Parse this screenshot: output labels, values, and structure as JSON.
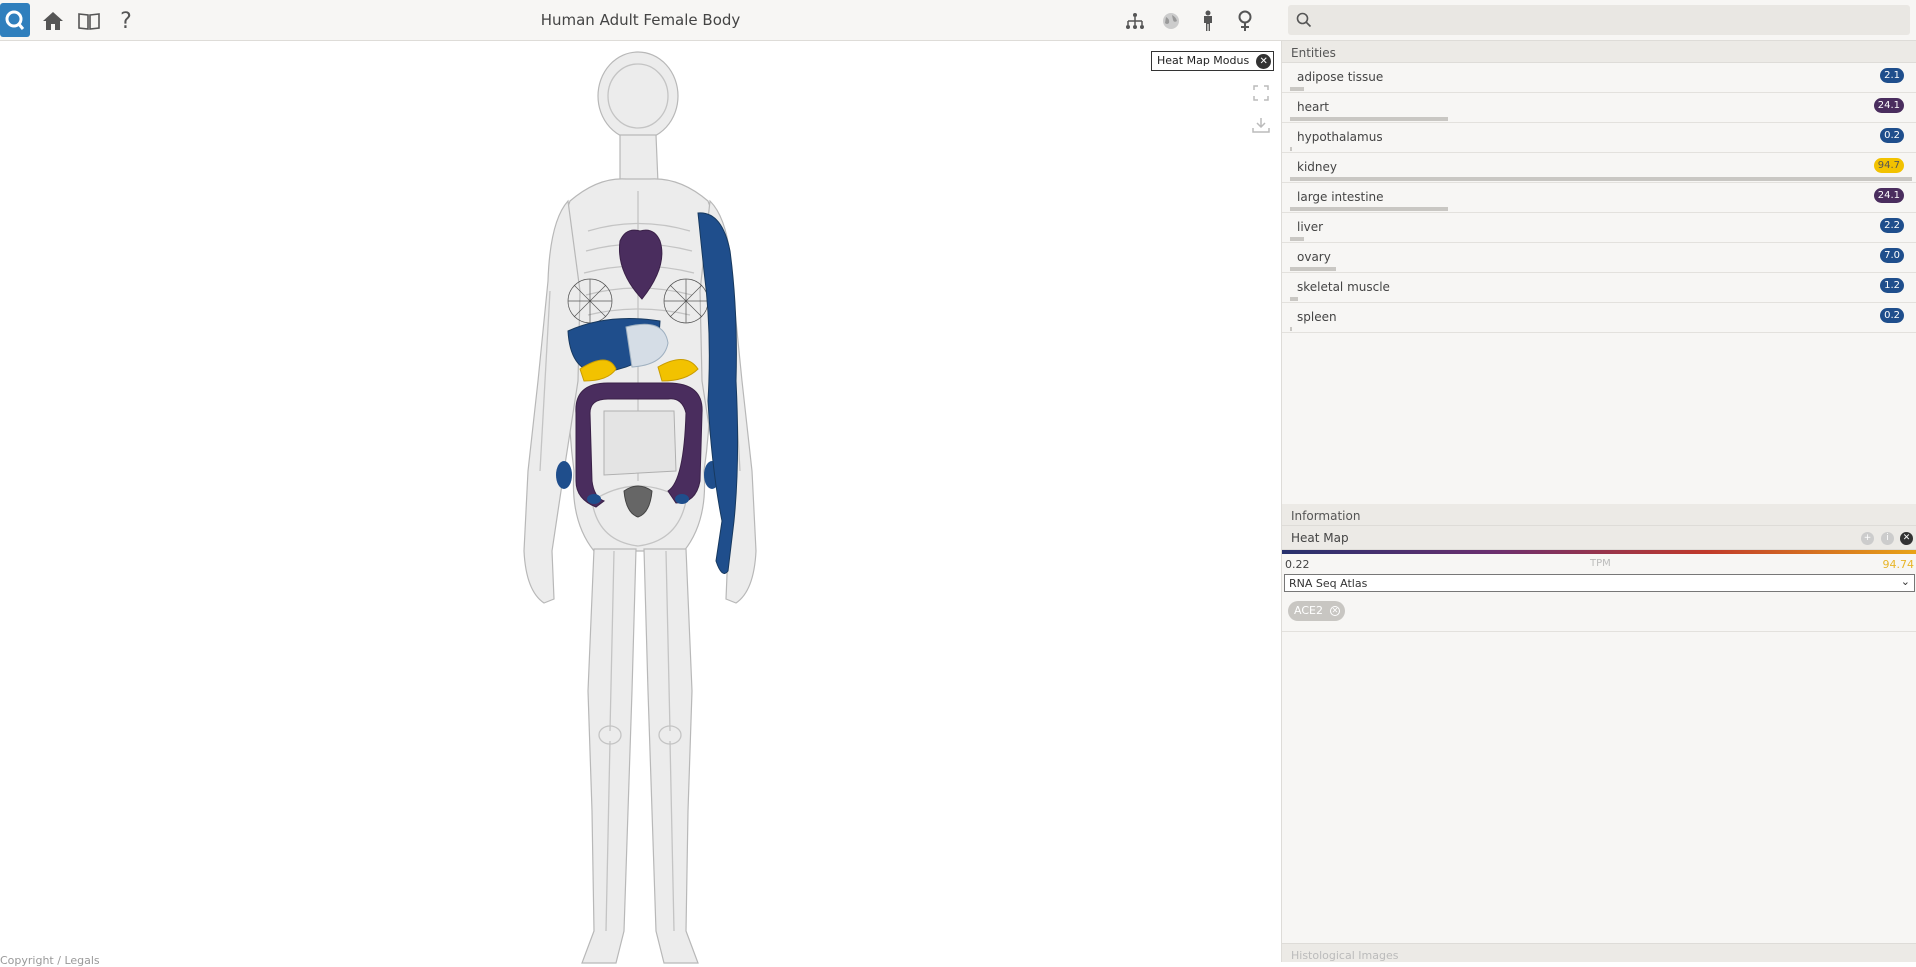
{
  "app": {
    "title": "Human Adult Female Body"
  },
  "toolbar": {
    "left_icons": [
      "app-logo-icon",
      "home-icon",
      "book-icon",
      "help-icon"
    ],
    "help_label": "?",
    "right_icons": [
      "hierarchy-icon",
      "globe-icon",
      "person-icon",
      "female-icon"
    ]
  },
  "search": {
    "placeholder": "",
    "value": ""
  },
  "canvas": {
    "heatmap_mode_label": "Heat Map Modus",
    "copyright": "Copyright / Legals"
  },
  "entities": {
    "header": "Entities",
    "items": [
      {
        "label": "adipose tissue",
        "value": "2.1",
        "color": "#1f4e8c",
        "fraction": 0.022
      },
      {
        "label": "heart",
        "value": "24.1",
        "color": "#4a2d5e",
        "fraction": 0.254
      },
      {
        "label": "hypothalamus",
        "value": "0.2",
        "color": "#1f4e8c",
        "fraction": 0.002
      },
      {
        "label": "kidney",
        "value": "94.7",
        "color": "#f2c200",
        "fraction": 1.0
      },
      {
        "label": "large intestine",
        "value": "24.1",
        "color": "#4a2d5e",
        "fraction": 0.254
      },
      {
        "label": "liver",
        "value": "2.2",
        "color": "#1f4e8c",
        "fraction": 0.023
      },
      {
        "label": "ovary",
        "value": "7.0",
        "color": "#1f4e8c",
        "fraction": 0.074
      },
      {
        "label": "skeletal muscle",
        "value": "1.2",
        "color": "#1f4e8c",
        "fraction": 0.013
      },
      {
        "label": "spleen",
        "value": "0.2",
        "color": "#1f4e8c",
        "fraction": 0.002
      }
    ]
  },
  "information": {
    "header": "Information",
    "heatmap": {
      "label": "Heat Map",
      "min": "0.22",
      "unit": "TPM",
      "max": "94.74",
      "dataset": "RNA Seq Atlas",
      "gene": "ACE2"
    }
  },
  "histology": {
    "header": "Histological Images"
  },
  "colors": {
    "low": "#1f4e8c",
    "mid": "#4a2d5e",
    "high": "#f2c200",
    "brand": "#2f7fbd"
  }
}
